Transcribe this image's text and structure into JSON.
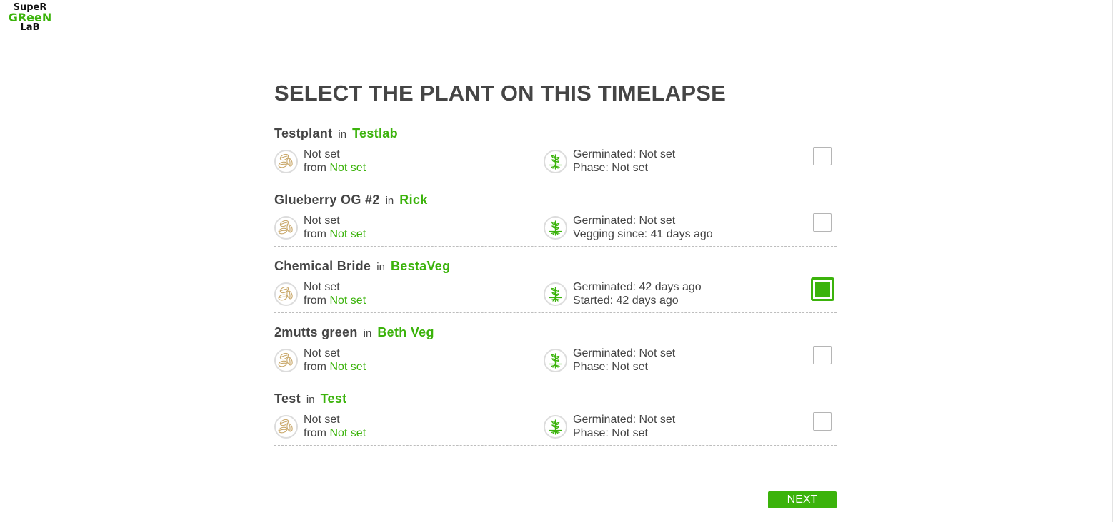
{
  "logo": {
    "line1": "SupeR",
    "line2": "GReeN",
    "line3": "LaB"
  },
  "title": "SELECT THE PLANT ON THIS TIMELAPSE",
  "in_label": "in",
  "plants": [
    {
      "name": "Testplant",
      "box": "Testlab",
      "seed_line": "Not set",
      "from_label": "from",
      "from_value": "Not set",
      "germinated_label": "Germinated:",
      "germinated_value": "Not set",
      "phase_line": "Phase: Not set",
      "checked": false
    },
    {
      "name": "Glueberry OG #2",
      "box": "Rick",
      "seed_line": "Not set",
      "from_label": "from",
      "from_value": "Not set",
      "germinated_label": "Germinated:",
      "germinated_value": "Not set",
      "phase_line": "Vegging since: 41 days ago",
      "checked": false
    },
    {
      "name": "Chemical Bride",
      "box": "BestaVeg",
      "seed_line": "Not set",
      "from_label": "from",
      "from_value": "Not set",
      "germinated_label": "Germinated:",
      "germinated_value": "42 days ago",
      "phase_line": "Started: 42 days ago",
      "checked": true
    },
    {
      "name": "2mutts green",
      "box": "Beth Veg",
      "seed_line": "Not set",
      "from_label": "from",
      "from_value": "Not set",
      "germinated_label": "Germinated:",
      "germinated_value": "Not set",
      "phase_line": "Phase: Not set",
      "checked": false
    },
    {
      "name": "Test",
      "box": "Test",
      "seed_line": "Not set",
      "from_label": "from",
      "from_value": "Not set",
      "germinated_label": "Germinated:",
      "germinated_value": "Not set",
      "phase_line": "Phase: Not set",
      "checked": false
    }
  ],
  "icons": {
    "seed": "seeds-icon",
    "phase": "sprout-icon"
  },
  "next_label": "NEXT",
  "colors": {
    "accent": "#3bb30b",
    "text": "#454545",
    "seed_icon": "#c9a86a"
  }
}
